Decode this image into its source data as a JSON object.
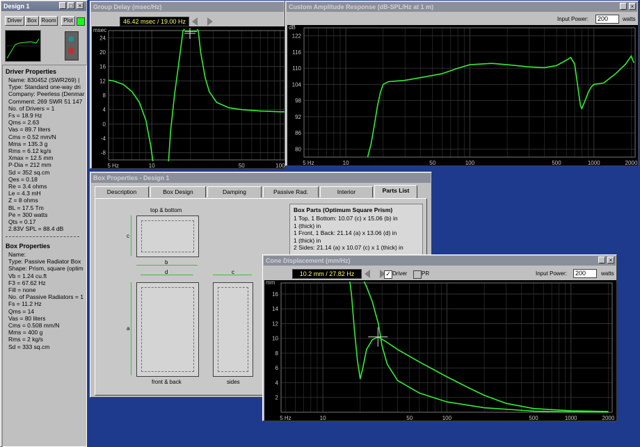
{
  "design_window": {
    "title": "Design 1",
    "buttons": [
      "Driver",
      "Box",
      "Room",
      "Plot"
    ],
    "driver_heading": "Driver Properties",
    "driver_props": [
      "Name: 830452  (SWR269)  |",
      "Type: Standard one-way dri",
      "Company: Peerless (Denmar",
      "Comment: 269 SWR 51 147",
      "No. of Drivers = 1",
      "Fs =  18.9 Hz",
      "Qms =  2.63",
      "Vas =  89.7 liters",
      "Cms =  0.52 mm/N",
      "Mms =  135.3 g",
      "Rms =  6.12 kg/s",
      "Xmax =  12.5 mm",
      "P-Dia =  212 mm",
      "Sd =  352 sq.cm",
      "Qes =  0.18",
      "Re =  3.4 ohms",
      "Le =  4.3 mH",
      "Z =  8 ohms",
      "BL =  17.5 Tm",
      "Pe =  300 watts",
      "Qts =  0.17",
      "2.83V SPL =  88.4 dB"
    ],
    "box_heading": "Box Properties",
    "box_props": [
      "Name:",
      "Type: Passive Radiator Box",
      "Shape: Prism, square (optim",
      "Vb =  1.24 cu.ft",
      "F3 =  67.62 Hz",
      "Fill = none",
      "No. of Passive Radiators = 1",
      "Fs =  11.2 Hz",
      "Qms =  14",
      "Vas =  80 liters",
      "Cms =  0.508 mm/N",
      "Mms =  400 g",
      "Rms =  2 kg/s",
      "Sd =  333 sq.cm"
    ]
  },
  "group_delay": {
    "title": "Group Delay (msec/Hz)",
    "readout": "46.42 msec / 19.00 Hz",
    "y_unit": "msec",
    "y_ticks": [
      "24",
      "20",
      "16",
      "12",
      "8",
      "4",
      "0",
      "-4",
      "-8"
    ],
    "x_ticks": [
      "5 Hz",
      "10",
      "50",
      "100"
    ]
  },
  "amplitude": {
    "title": "Custom Amplitude Response (dB-SPL/Hz at 1 m)",
    "input_power_label": "Input Power:",
    "input_power_value": "200",
    "watts": "watts",
    "y_unit": "dB",
    "y_ticks": [
      "122",
      "116",
      "110",
      "104",
      "98",
      "92",
      "86",
      "80"
    ],
    "x_ticks": [
      "5 Hz",
      "10",
      "50",
      "100",
      "500",
      "1000",
      "2000"
    ]
  },
  "box_properties": {
    "title": "Box Properties - Design 1",
    "tabs": [
      "Description",
      "Box Design",
      "Damping",
      "Passive Rad.",
      "Interior",
      "Parts List"
    ],
    "top_label": "top & bottom",
    "front_label": "front & back",
    "sides_label": "sides",
    "dim_b": "b",
    "dim_c": "c",
    "dim_d": "d",
    "dim_a": "a",
    "parts_heading": "Box Parts (Optimum Square Prism)",
    "parts": [
      "1 Top, 1 Bottom:  10.07 (c) x 15.06 (b) in",
      "   1 (thick) in",
      "1 Front, 1 Back:  21.14 (a) x 13.06 (d) in",
      "   1 (thick) in",
      "2 Sides:  21.14 (a) x 10.07 (c) x 1 (thick) in"
    ]
  },
  "cone": {
    "title": "Cone Displacement (mm/Hz)",
    "readout": "10.2 mm / 27.82 Hz",
    "driver_label": "Driver",
    "pr_label": "PR",
    "input_power_label": "Input Power:",
    "input_power_value": "200",
    "watts": "watts",
    "y_unit": "mm",
    "y_ticks": [
      "16",
      "14",
      "12",
      "10",
      "8",
      "6",
      "4",
      "2"
    ],
    "x_ticks": [
      "5 Hz",
      "10",
      "50",
      "100",
      "500",
      "1000",
      "2000"
    ]
  },
  "colors": {
    "curve": "#33ee33",
    "grid": "#3a3a3a",
    "desktop": "#1e3a8c",
    "readout": "#ffff66"
  }
}
